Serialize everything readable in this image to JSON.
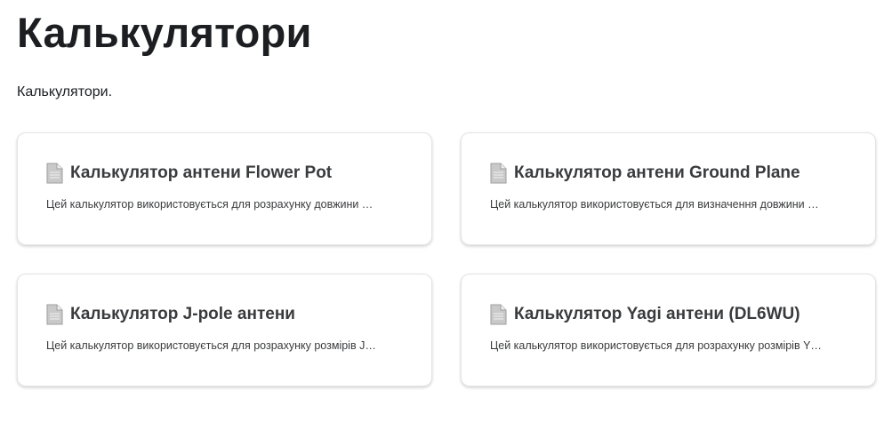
{
  "header": {
    "title": "Калькулятори",
    "description": "Калькулятори."
  },
  "cards": [
    {
      "icon": "document-icon",
      "title": "Калькулятор антени Flower Pot",
      "description": "Цей калькулятор використовується для розрахунку довжини …"
    },
    {
      "icon": "document-icon",
      "title": "Калькулятор антени Ground Plane",
      "description": "Цей калькулятор використовується для визначення довжини …"
    },
    {
      "icon": "document-icon",
      "title": "Калькулятор J-pole антени",
      "description": "Цей калькулятор використовується для розрахунку розмірів J…"
    },
    {
      "icon": "document-icon",
      "title": "Калькулятор Yagi антени (DL6WU)",
      "description": "Цей калькулятор використовується для розрахунку розмірів Y…"
    }
  ]
}
